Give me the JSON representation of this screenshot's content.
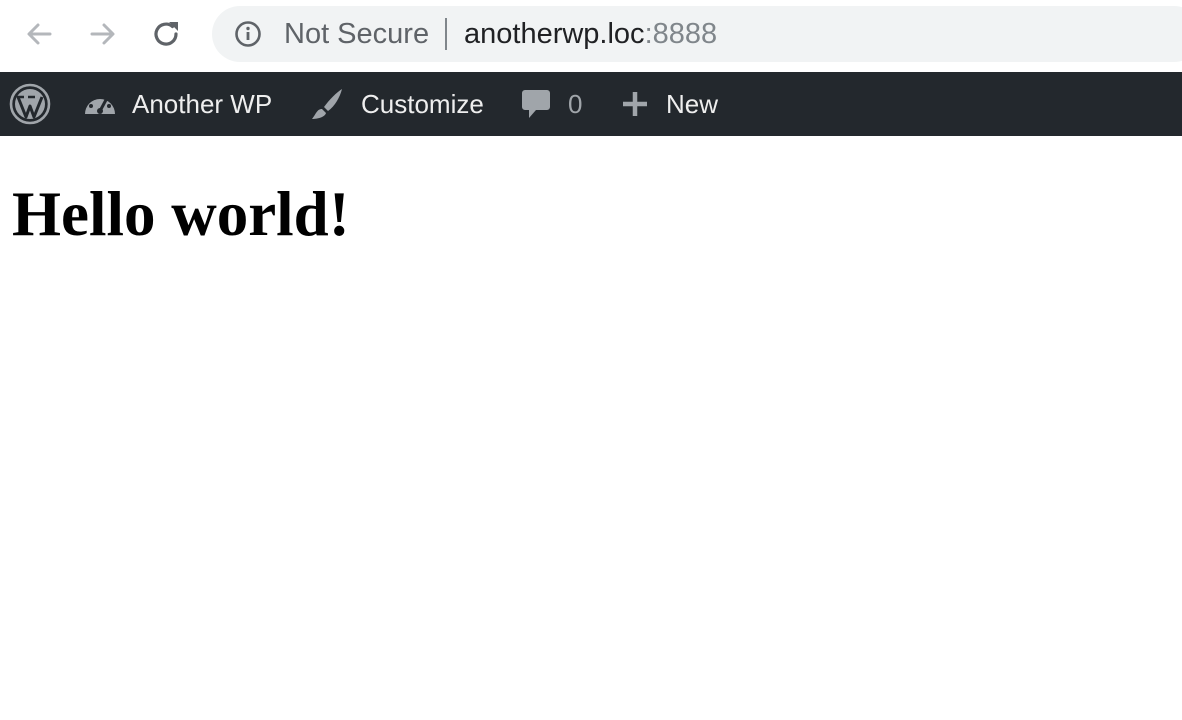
{
  "browser": {
    "security_label": "Not Secure",
    "url_host": "anotherwp.loc",
    "url_port": ":8888",
    "icons": {
      "back": "arrow-left-icon",
      "forward": "arrow-right-icon",
      "reload": "reload-icon",
      "info": "info-icon"
    }
  },
  "admin_bar": {
    "site_name": "Another WP",
    "customize_label": "Customize",
    "comments_count": "0",
    "new_label": "New",
    "background_color": "#23282d",
    "text_color": "#eeeeee"
  },
  "page": {
    "heading": "Hello world!"
  }
}
